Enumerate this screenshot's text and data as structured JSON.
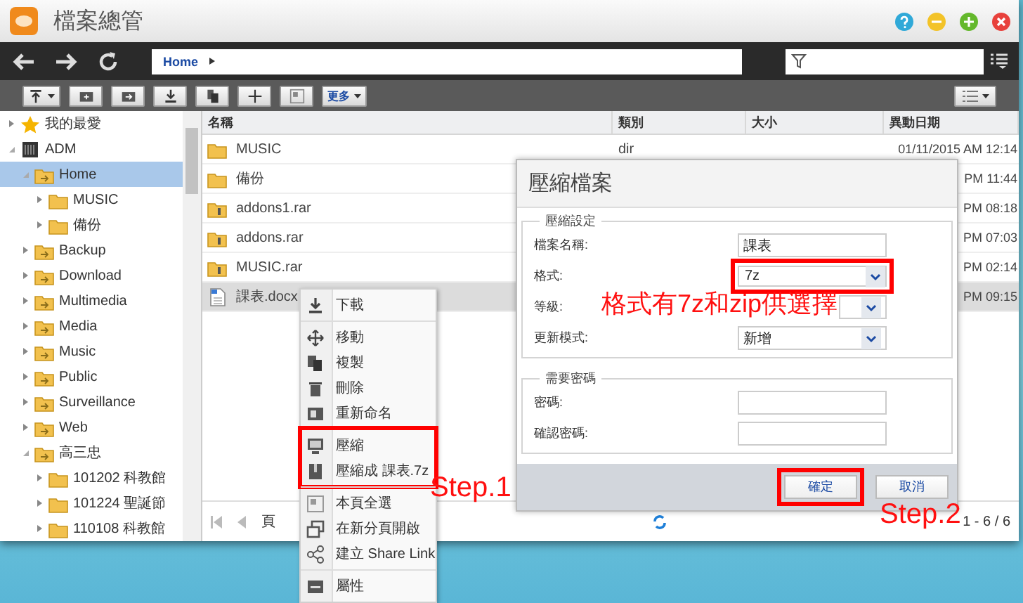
{
  "window": {
    "title": "檔案總管"
  },
  "nav": {
    "path": "Home"
  },
  "toolbar": {
    "more_label": "更多"
  },
  "sidebar": {
    "items": [
      {
        "label": "我的最愛",
        "kind": "favorites",
        "expanded": false,
        "selected": false
      },
      {
        "label": "ADM",
        "kind": "device",
        "expanded": true,
        "selected": false,
        "children": [
          {
            "label": "Home",
            "kind": "share",
            "expanded": true,
            "selected": true,
            "children": [
              {
                "label": "MUSIC",
                "kind": "folder",
                "expanded": false,
                "selected": false
              },
              {
                "label": "備份",
                "kind": "folder",
                "expanded": false,
                "selected": false
              }
            ]
          },
          {
            "label": "Backup",
            "kind": "share",
            "expanded": false,
            "selected": false
          },
          {
            "label": "Download",
            "kind": "share",
            "expanded": false,
            "selected": false
          },
          {
            "label": "Multimedia",
            "kind": "share",
            "expanded": false,
            "selected": false
          },
          {
            "label": "Media",
            "kind": "share",
            "expanded": false,
            "selected": false
          },
          {
            "label": "Music",
            "kind": "share",
            "expanded": false,
            "selected": false
          },
          {
            "label": "Public",
            "kind": "share",
            "expanded": false,
            "selected": false
          },
          {
            "label": "Surveillance",
            "kind": "share",
            "expanded": false,
            "selected": false
          },
          {
            "label": "Web",
            "kind": "share",
            "expanded": false,
            "selected": false
          },
          {
            "label": "高三忠",
            "kind": "share",
            "expanded": true,
            "selected": false,
            "children": [
              {
                "label": "101202 科教館",
                "kind": "folder",
                "expanded": false,
                "selected": false
              },
              {
                "label": "101224 聖誕節",
                "kind": "folder",
                "expanded": false,
                "selected": false
              },
              {
                "label": "110108 科教館",
                "kind": "folder",
                "expanded": false,
                "selected": false
              }
            ]
          }
        ]
      }
    ]
  },
  "table": {
    "columns": [
      "名稱",
      "類別",
      "大小",
      "異動日期"
    ],
    "rows": [
      {
        "name": "MUSIC",
        "kind": "folder",
        "type": "dir",
        "modified": "01/11/2015 AM 12:14",
        "selected": false
      },
      {
        "name": "備份",
        "kind": "folder",
        "modified": "PM 11:44",
        "selected": false
      },
      {
        "name": "addons1.rar",
        "kind": "archive",
        "modified": "PM 08:18",
        "selected": false
      },
      {
        "name": "addons.rar",
        "kind": "archive",
        "modified": "PM 07:03",
        "selected": false
      },
      {
        "name": "MUSIC.rar",
        "kind": "archive",
        "modified": "PM 02:14",
        "selected": false
      },
      {
        "name": "課表.docx",
        "kind": "document",
        "modified": "PM 09:15",
        "selected": true
      }
    ]
  },
  "pagination": {
    "page_label": "頁",
    "count": "1 - 6 / 6"
  },
  "context_menu": {
    "groups": [
      {
        "highlighted": false,
        "items": [
          "下載"
        ]
      },
      {
        "highlighted": false,
        "items": [
          "移動",
          "複製",
          "刪除",
          "重新命名"
        ]
      },
      {
        "highlighted": true,
        "items": [
          "壓縮",
          "壓縮成 課表.7z"
        ]
      },
      {
        "highlighted": false,
        "items": [
          "本頁全選",
          "在新分頁開啟",
          "建立 Share Link"
        ]
      },
      {
        "highlighted": false,
        "items": [
          "屬性"
        ]
      }
    ]
  },
  "dialog": {
    "title": "壓縮檔案",
    "sections": [
      {
        "legend": "壓縮設定",
        "fields": [
          {
            "label": "檔案名稱:",
            "kind": "text",
            "value": "課表",
            "highlighted": false
          },
          {
            "label": "格式:",
            "kind": "select",
            "value": "7z",
            "highlighted": true
          },
          {
            "label": "等級:",
            "kind": "select",
            "highlighted": false
          },
          {
            "label": "更新模式:",
            "kind": "select",
            "value": "新增",
            "highlighted": false
          }
        ]
      },
      {
        "legend": "需要密碼",
        "fields": [
          {
            "label": "密碼:",
            "kind": "text",
            "highlighted": false
          },
          {
            "label": "確認密碼:",
            "kind": "text",
            "highlighted": false
          }
        ]
      }
    ],
    "buttons": [
      {
        "label": "確定",
        "highlighted": true
      },
      {
        "label": "取消",
        "highlighted": false
      }
    ]
  },
  "annotations": [
    {
      "text": "Step.1"
    },
    {
      "text": "格式有7z和zip供選擇"
    },
    {
      "text": "Step.2"
    }
  ]
}
